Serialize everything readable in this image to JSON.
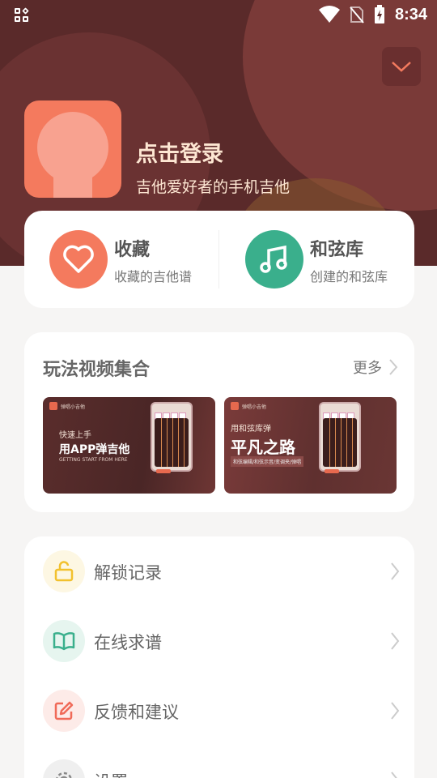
{
  "status_bar": {
    "time": "8:34",
    "icons": [
      "apps-grid-icon",
      "wifi-icon",
      "no-sim-icon",
      "battery-charging-icon"
    ]
  },
  "header": {
    "login_title": "点击登录",
    "login_subtitle": "吉他爱好者的手机吉他",
    "dropdown_icon": "chevron-down-icon",
    "colors": {
      "background": "#5a2a2a",
      "accent": "#f47a5e",
      "text": "#fde6d2"
    }
  },
  "quick_actions": [
    {
      "title": "收藏",
      "subtitle": "收藏的吉他谱",
      "icon": "heart-icon",
      "color": "#f47a5e"
    },
    {
      "title": "和弦库",
      "subtitle": "创建的和弦库",
      "icon": "music-note-icon",
      "color": "#3aaf8c"
    }
  ],
  "videos": {
    "title": "玩法视频集合",
    "more_label": "更多",
    "items": [
      {
        "logo_text": "弹唱小吉他",
        "line1": "快速上手",
        "line2": "用APP弹吉他",
        "line3": "GETTING START FROM HERE"
      },
      {
        "logo_text": "弹唱小吉他",
        "line1": "用和弦库弹",
        "line2": "平凡之路",
        "line3": "和弦编辑/和弦示音/变调夹/弹唱"
      }
    ]
  },
  "menu": [
    {
      "label": "解锁记录",
      "icon": "unlock-icon",
      "color": "#f2c12e",
      "bg": "#fdf7e3"
    },
    {
      "label": "在线求谱",
      "icon": "book-open-icon",
      "color": "#3aaf8c",
      "bg": "#e6f5ef"
    },
    {
      "label": "反馈和建议",
      "icon": "edit-icon",
      "color": "#f06a58",
      "bg": "#fdebe8"
    },
    {
      "label": "设置",
      "icon": "gear-icon",
      "color": "#888888",
      "bg": "#efefef"
    }
  ]
}
